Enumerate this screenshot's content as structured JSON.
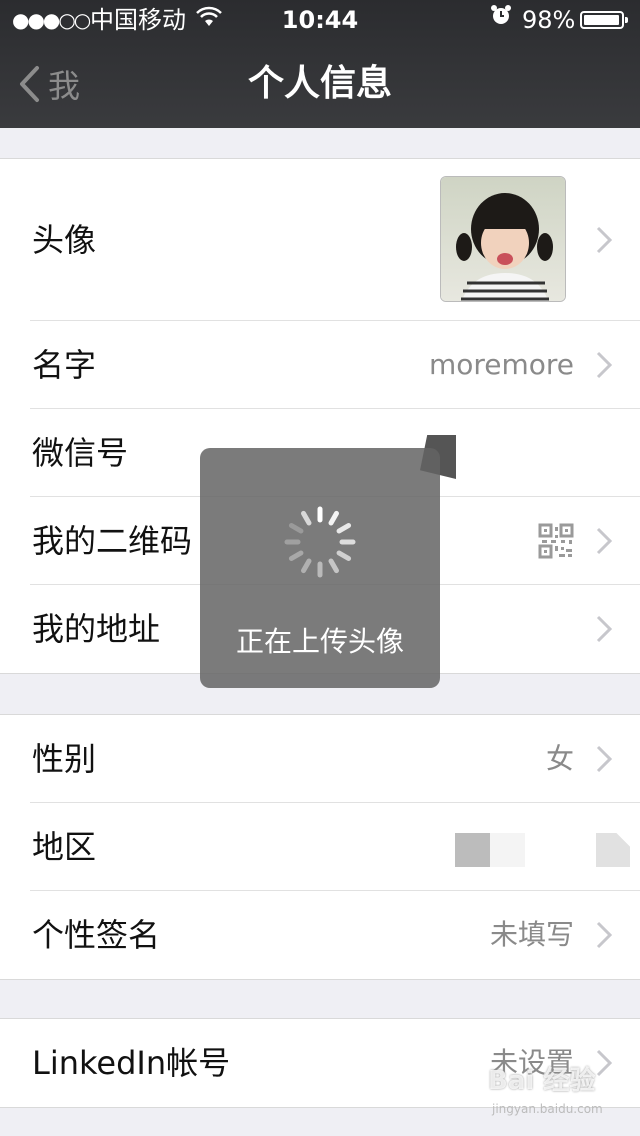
{
  "status_bar": {
    "signal": "●●●○○",
    "carrier": "中国移动",
    "time": "10:44",
    "battery": "98%",
    "battery_level": 0.98
  },
  "nav": {
    "back_label": "我",
    "title": "个人信息"
  },
  "profile": {
    "avatar_label": "头像",
    "name_label": "名字",
    "name_value": "moremore",
    "wechat_id_label": "微信号",
    "qrcode_label": "我的二维码",
    "address_label": "我的地址"
  },
  "details": {
    "gender_label": "性别",
    "gender_value": "女",
    "region_label": "地区",
    "signature_label": "个性签名",
    "signature_value": "未填写"
  },
  "linkedin": {
    "label": "LinkedIn帐号",
    "value": "未设置"
  },
  "loading": {
    "message": "正在上传头像"
  },
  "watermark": {
    "text": "Bai 经验",
    "sub": "jingyan.baidu.com"
  },
  "colors": {
    "nav_bg": "#2b2c2f",
    "page_bg": "#efeff4",
    "value_text": "#8a8a8a"
  }
}
